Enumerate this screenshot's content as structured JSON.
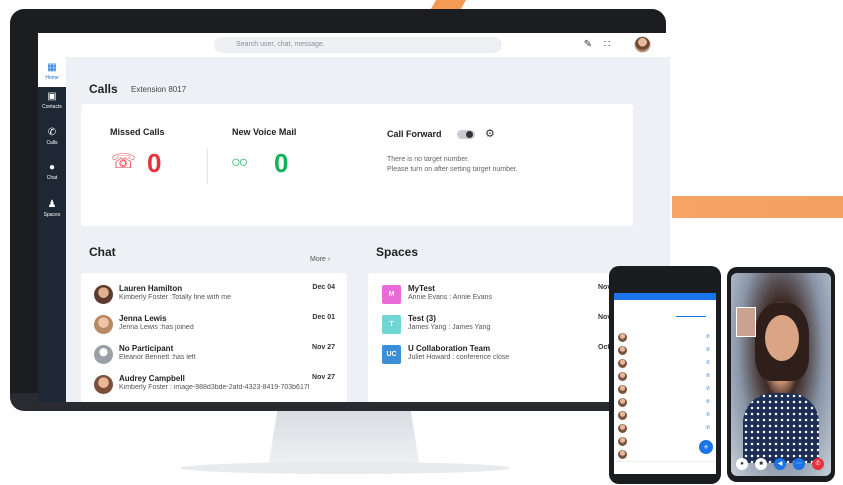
{
  "topbar": {
    "search_placeholder": "Search user, chat, message."
  },
  "nav": {
    "items": [
      {
        "label": "Home",
        "icon": "grid-icon"
      },
      {
        "label": "Contacts",
        "icon": "contact-card-icon"
      },
      {
        "label": "Calls",
        "icon": "phone-icon"
      },
      {
        "label": "Chat",
        "icon": "chat-bubble-icon"
      },
      {
        "label": "Spaces",
        "icon": "group-icon"
      }
    ]
  },
  "calls": {
    "title": "Calls",
    "extension": "Extension 8017",
    "missed_label": "Missed Calls",
    "missed_count": "0",
    "voicemail_label": "New Voice Mail",
    "voicemail_count": "0",
    "forward_label": "Call Forward",
    "forward_note_1": "There is no target number.",
    "forward_note_2": "Please turn on after setting target number."
  },
  "chat": {
    "title": "Chat",
    "more": "More",
    "rows": [
      {
        "name": "Lauren Hamilton",
        "message": "Kimberly Foster :Totally fine with me",
        "date": "Dec 04"
      },
      {
        "name": "Jenna Lewis",
        "message": "Jenna Lewis :has joined",
        "date": "Dec 01"
      },
      {
        "name": "No Participant",
        "message": "Eleanor Bennett :has left",
        "date": "Nov 27"
      },
      {
        "name": "Audrey Campbell",
        "message": "Kimberly Foster : image-988d3bde-2afd-4323-8419-703b617f",
        "date": "Nov 27"
      }
    ]
  },
  "spaces": {
    "title": "Spaces",
    "rows": [
      {
        "badge": "M",
        "name": "MyTest",
        "message": "Annie Evans : Annie Evans",
        "date": "Nov",
        "color": "#e86bd8"
      },
      {
        "badge": "T",
        "name": "Test (3)",
        "message": "James Yang : James Yang",
        "date": "Nov",
        "color": "#6fd6d6"
      },
      {
        "badge": "UC",
        "name": "U Collaboration Team",
        "message": "Juliet Howard : conference close",
        "date": "Oct",
        "color": "#3a8fd6"
      }
    ]
  },
  "colors": {
    "missed": "#e8313b",
    "voicemail": "#10b356",
    "accent": "#1a73e8",
    "orange": "#f4a060"
  }
}
